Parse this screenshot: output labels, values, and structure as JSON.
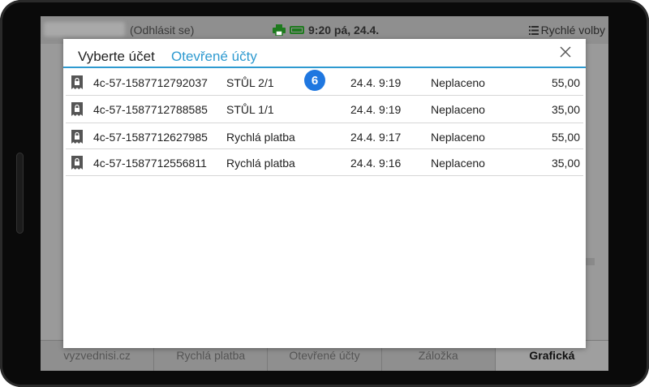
{
  "topbar": {
    "logout": "(Odhlásit se)",
    "clock": "9:20 pá, 24.4.",
    "quick_menu": "Rychlé volby",
    "icons": [
      "printer-icon",
      "battery-icon",
      "list-icon"
    ],
    "status_color": "#1e7a1e"
  },
  "dialog": {
    "title": "Vyberte účet",
    "tab": "Otevřené účty",
    "accent_color": "#2e9ad0",
    "rows": [
      {
        "id": "4c-57-1587712792037",
        "table": "STŮL 2/1",
        "time": "24.4. 9:19",
        "state": "Neplaceno",
        "amount": "55,00"
      },
      {
        "id": "4c-57-1587712788585",
        "table": "STŮL 1/1",
        "time": "24.4. 9:19",
        "state": "Neplaceno",
        "amount": "35,00"
      },
      {
        "id": "4c-57-1587712627985",
        "table": "Rychlá platba",
        "time": "24.4. 9:17",
        "state": "Neplaceno",
        "amount": "55,00"
      },
      {
        "id": "4c-57-1587712556811",
        "table": "Rychlá platba",
        "time": "24.4. 9:16",
        "state": "Neplaceno",
        "amount": "35,00"
      }
    ]
  },
  "badge": {
    "label": "6",
    "color": "#1f77e0"
  },
  "bottom_tabs": [
    "vyzvednisi.cz",
    "Rychlá platba",
    "Otevřené účty",
    "Záložka",
    "Grafická"
  ]
}
